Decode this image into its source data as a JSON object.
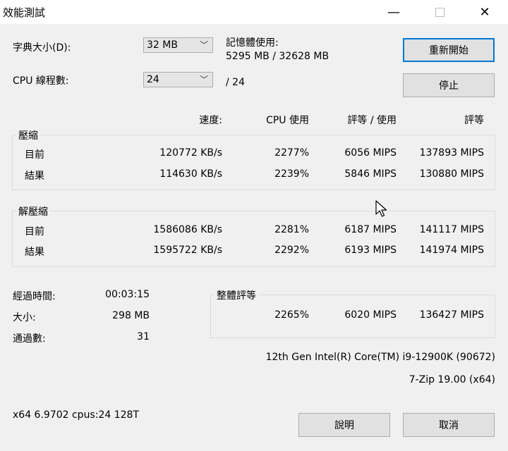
{
  "window": {
    "title": "效能測試",
    "minimize_glyph": "—",
    "close_glyph": "✕"
  },
  "settings": {
    "dict_label": "字典大小(D):",
    "dict_value": "32 MB",
    "threads_label": "CPU 線程數:",
    "threads_value": "24",
    "threads_total": "/ 24",
    "memory_label": "記憶體使用:",
    "memory_value": "5295 MB / 32628 MB"
  },
  "buttons": {
    "restart": "重新開始",
    "stop": "停止",
    "help": "說明",
    "cancel": "取消"
  },
  "columns": {
    "speed": "速度:",
    "cpu_usage": "CPU 使用",
    "rating_usage": "評等 / 使用",
    "rating": "評等"
  },
  "compress": {
    "title": "壓縮",
    "rows": [
      {
        "label": "目前",
        "speed": "120772 KB/s",
        "cpu": "2277%",
        "rating_usage": "6056 MIPS",
        "rating": "137893 MIPS"
      },
      {
        "label": "結果",
        "speed": "114630 KB/s",
        "cpu": "2239%",
        "rating_usage": "5846 MIPS",
        "rating": "130880 MIPS"
      }
    ]
  },
  "decompress": {
    "title": "解壓縮",
    "rows": [
      {
        "label": "目前",
        "speed": "1586086 KB/s",
        "cpu": "2281%",
        "rating_usage": "6187 MIPS",
        "rating": "141117 MIPS"
      },
      {
        "label": "結果",
        "speed": "1595722 KB/s",
        "cpu": "2292%",
        "rating_usage": "6193 MIPS",
        "rating": "141974 MIPS"
      }
    ]
  },
  "stats": {
    "elapsed_label": "經過時間:",
    "elapsed_value": "00:03:15",
    "size_label": "大小:",
    "size_value": "298 MB",
    "passes_label": "通過數:",
    "passes_value": "31"
  },
  "total": {
    "title": "整體評等",
    "cpu": "2265%",
    "rating_usage": "6020 MIPS",
    "rating": "136427 MIPS"
  },
  "system": {
    "cpu_name": "12th Gen Intel(R) Core(TM) i9-12900K (90672)",
    "app_version": "7-Zip 19.00 (x64)",
    "build_info": "x64 6.9702 cpus:24 128T"
  }
}
